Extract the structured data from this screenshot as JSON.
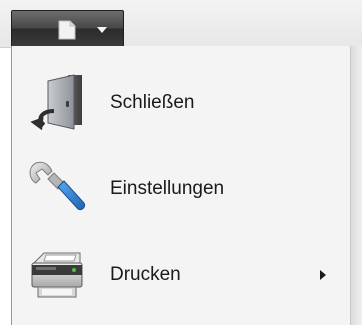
{
  "app_menu": {
    "button_icon": "document-icon",
    "dropdown_icon": "chevron-down-icon"
  },
  "menu": {
    "items": [
      {
        "label": "Schließen",
        "icon": "door-exit-icon",
        "has_submenu": false
      },
      {
        "label": "Einstellungen",
        "icon": "wrench-icon",
        "has_submenu": false
      },
      {
        "label": "Drucken",
        "icon": "printer-icon",
        "has_submenu": true
      }
    ]
  },
  "colors": {
    "app_button": "#3a3a3a",
    "menu_background": "#f4f4f4",
    "text": "#1a1a1a",
    "wrench_handle": "#2a7fd4"
  }
}
